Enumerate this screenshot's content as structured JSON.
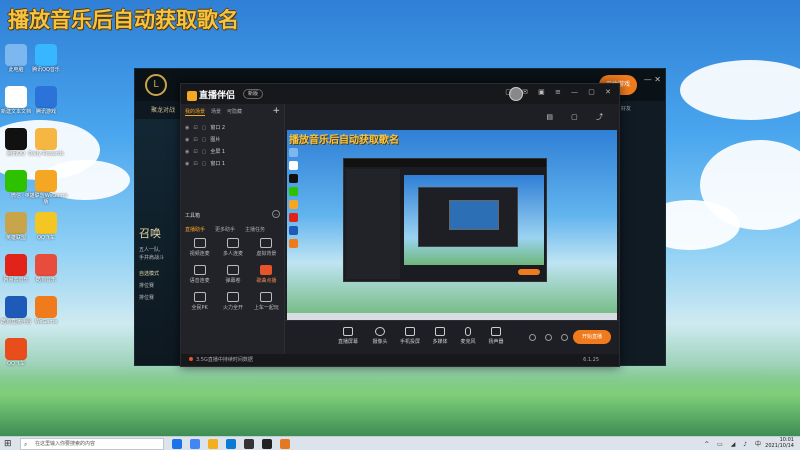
{
  "title": "播放音乐后自动获取歌名",
  "desktop_icons": [
    {
      "label": "此电脑",
      "color": "#7db7f0"
    },
    {
      "label": "腾讯QQ音乐",
      "color": "#38b6ff"
    },
    {
      "label": "新建文本文档",
      "color": "#ffffff"
    },
    {
      "label": "腾讯游戏",
      "color": "#2b73d8"
    },
    {
      "label": "腾讯QQ",
      "color": "#111111"
    },
    {
      "label": "Daily Rewards",
      "color": "#f5b642"
    },
    {
      "label": "微信",
      "color": "#2dc100"
    },
    {
      "label": "英雄联盟WeGame版",
      "color": "#f5a623"
    },
    {
      "label": "英雄联盟",
      "color": "#c8a44a"
    },
    {
      "label": "QQ飞车",
      "color": "#f3c623"
    },
    {
      "label": "网易云音乐",
      "color": "#e2231a"
    },
    {
      "label": "酷狗音乐",
      "color": "#e74c3c"
    },
    {
      "label": "酷狗直播伴侣",
      "color": "#1e5bb8"
    },
    {
      "label": "WeGame",
      "color": "#f07b1c"
    },
    {
      "label": "QQ飞车",
      "color": "#e84d1c"
    }
  ],
  "lol": {
    "logo": "L",
    "tab": "聚龙对战",
    "heading": "召唤",
    "side_text_1": "五人一队,",
    "side_text_2": "手并肩战斗",
    "side_items": [
      "自选模式",
      "排位赛",
      "排位赛"
    ],
    "play_label": "开始游戏",
    "right_label": "好友"
  },
  "companion": {
    "app_name": "直播伴侣",
    "pill": "新版",
    "scene_tabs": [
      "我的场景",
      "场景",
      "可隐藏"
    ],
    "layers": [
      "窗口 2",
      "图片",
      "全屏 1",
      "窗口 1"
    ],
    "tools_head": "工具箱",
    "tool_tabs": [
      "直播助手",
      "更多助手",
      "主播任务"
    ],
    "tools": [
      {
        "label": "视频连麦",
        "highlight": false
      },
      {
        "label": "多人连麦",
        "highlight": false
      },
      {
        "label": "虚拟背景",
        "highlight": false
      },
      {
        "label": "语音连麦",
        "highlight": false
      },
      {
        "label": "弹幕卷",
        "highlight": false
      },
      {
        "label": "歌曲点播",
        "highlight": true
      },
      {
        "label": "全民PK",
        "highlight": false
      },
      {
        "label": "火力全开",
        "highlight": false
      },
      {
        "label": "上车一起玩",
        "highlight": false
      }
    ],
    "preview_title": "播放音乐后自动获取歌名",
    "controls": [
      "直播屏幕",
      "摄像头",
      "手机投屏",
      "多媒体",
      "麦克风",
      "扬声器"
    ],
    "go_live": "开始直播",
    "status": "3.5G直播中持续时间数据",
    "version": "6.1.25"
  },
  "taskbar": {
    "search_placeholder": "在这里输入你要搜索的内容",
    "time": "10:01",
    "date": "2021/10/14",
    "apps": [
      "#1a73e8",
      "#4285f4",
      "#f2b01e",
      "#0b7ad3",
      "#333333",
      "#222222",
      "#e47924"
    ]
  }
}
